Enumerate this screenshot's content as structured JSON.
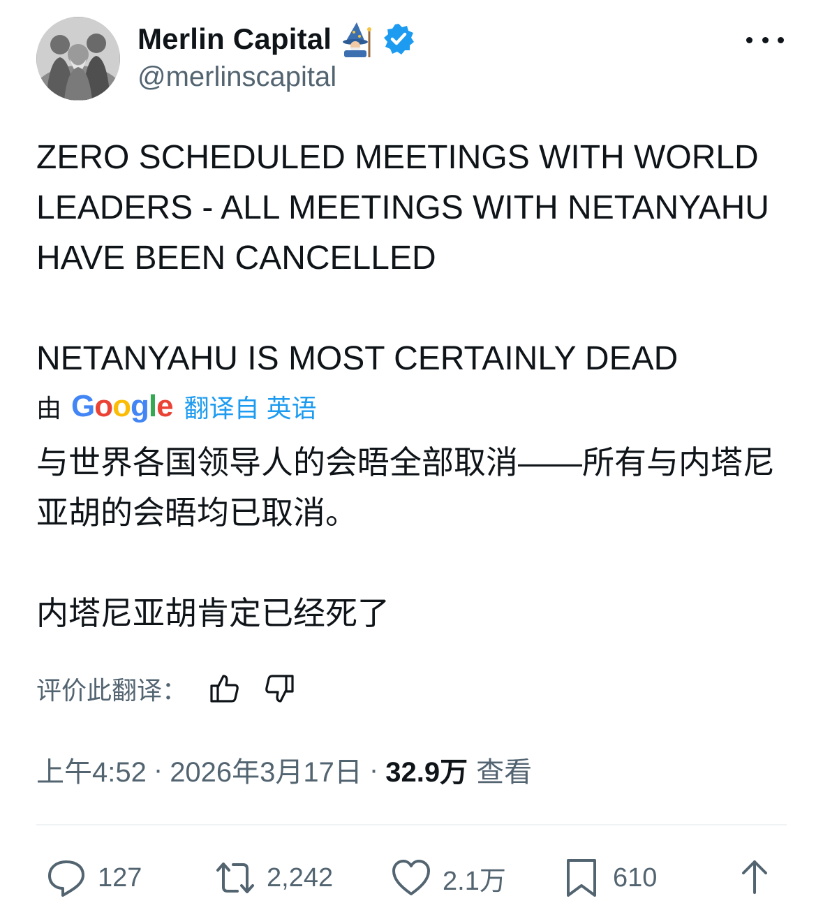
{
  "author": {
    "display_name": "Merlin Capital",
    "handle": "@merlinscapital"
  },
  "tweet": {
    "text_line1": "ZERO SCHEDULED MEETINGS WITH WORLD LEADERS - ALL MEETINGS WITH NETANYAHU HAVE BEEN CANCELLED",
    "text_line2": "NETANYAHU IS MOST CERTAINLY DEAD"
  },
  "translation": {
    "by_label": "由",
    "provider": "Google",
    "link_label": "翻译自 英语",
    "text_line1": "与世界各国领导人的会晤全部取消——所有与内塔尼亚胡的会晤均已取消。",
    "text_line2": "内塔尼亚胡肯定已经死了",
    "rate_label": "评价此翻译："
  },
  "meta": {
    "time": "上午4:52",
    "separator": "·",
    "date": "2026年3月17日",
    "views_count": "32.9万",
    "views_label": "查看"
  },
  "actions": {
    "replies": "127",
    "reposts": "2,242",
    "likes": "2.1万",
    "bookmarks": "610"
  },
  "icons": {
    "avatar": "painting-avatar",
    "emoji": "wizard-emoji-icon",
    "verified": "verified-badge-icon",
    "more": "more-icon",
    "thumbs_up": "thumbs-up-icon",
    "thumbs_down": "thumbs-down-icon",
    "reply": "reply-icon",
    "repost": "repost-icon",
    "like": "heart-icon",
    "bookmark": "bookmark-icon",
    "share": "share-icon"
  },
  "colors": {
    "text": "#0f1419",
    "secondary": "#536471",
    "link": "#1d9bf0",
    "divider": "#eff3f4"
  }
}
